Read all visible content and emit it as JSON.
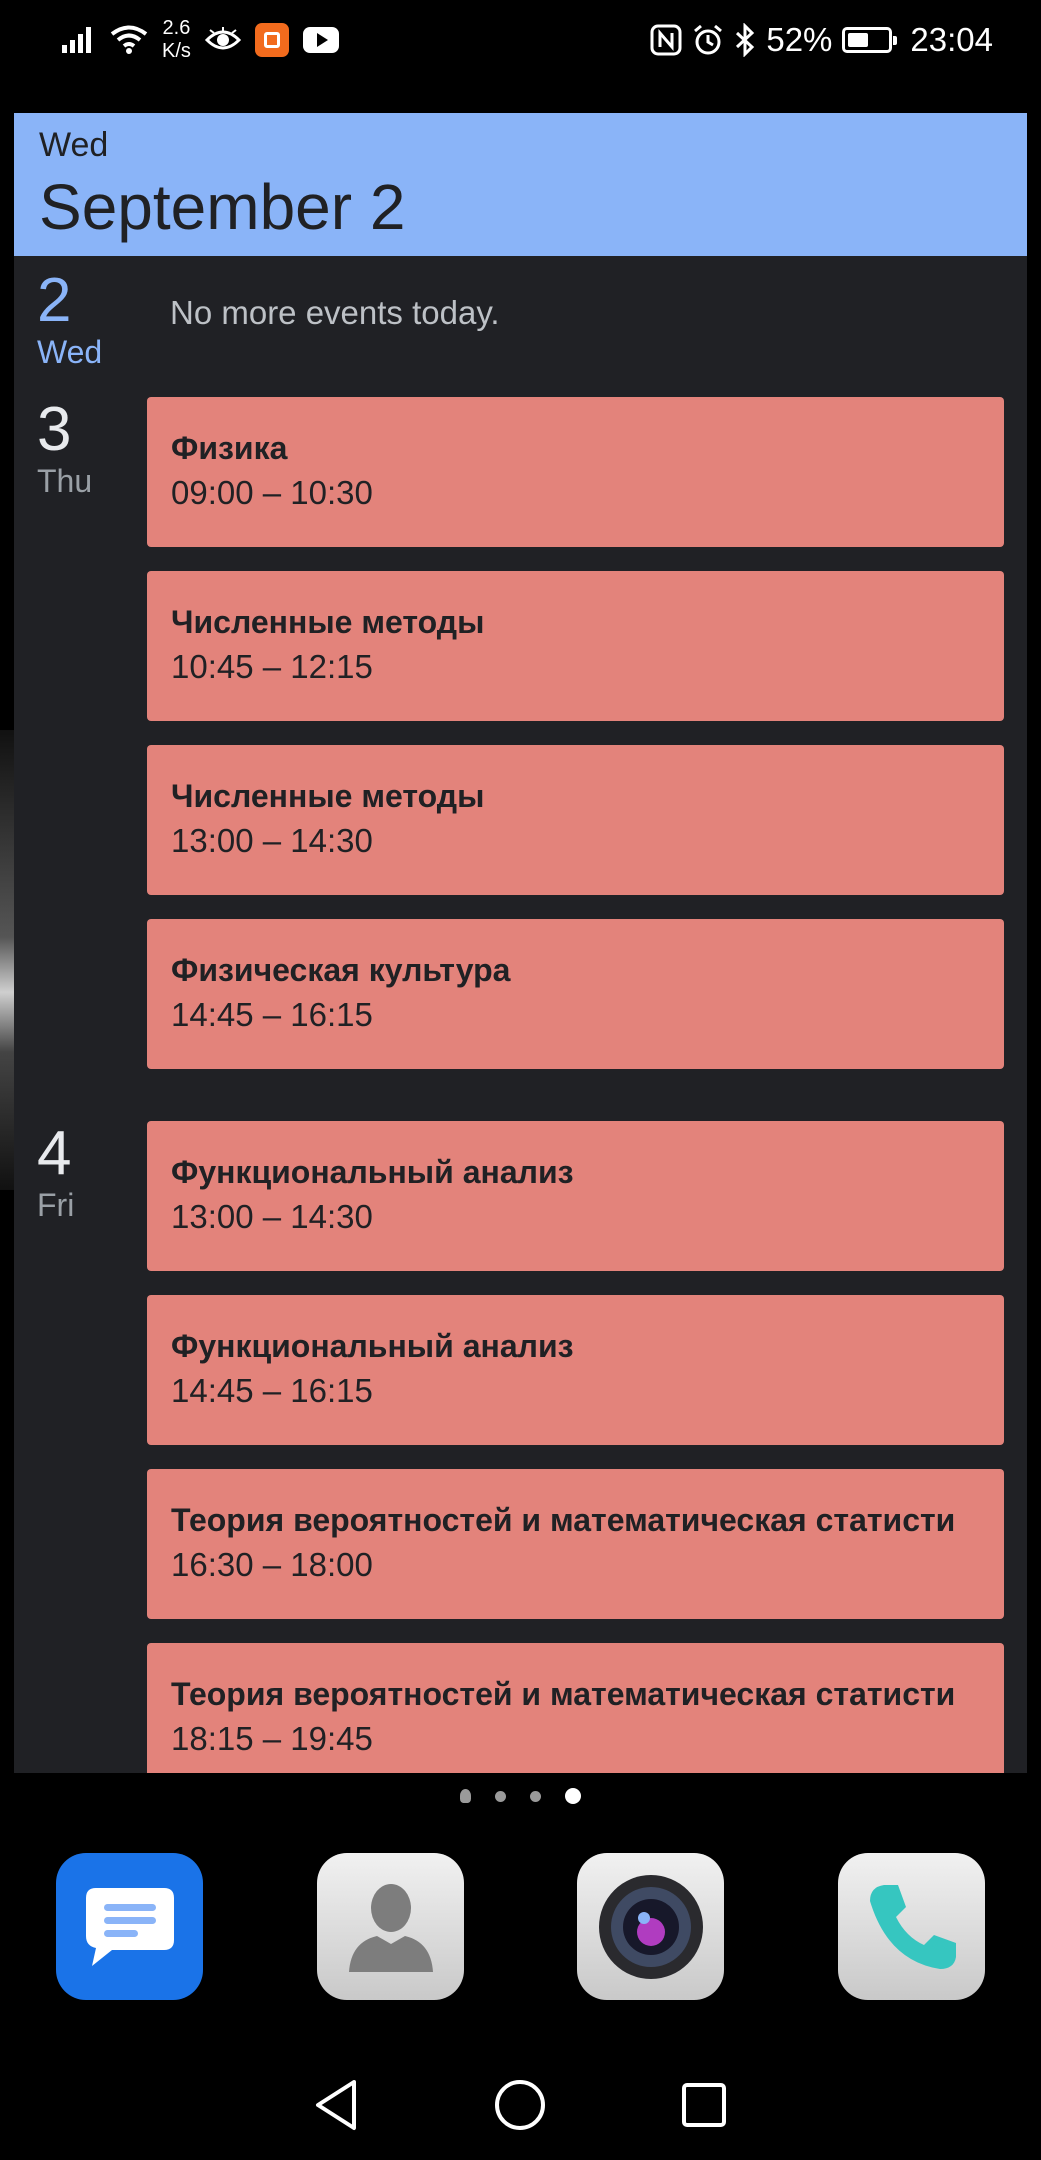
{
  "status_bar": {
    "network_speed": [
      "2.6",
      "K/s"
    ],
    "battery_percent": "52%",
    "battery_level": 0.52,
    "time": "23:04",
    "icons": [
      "signal-icon",
      "wifi-icon",
      "eye-icon",
      "mi-app-icon",
      "youtube-icon",
      "nfc-icon",
      "alarm-icon",
      "bluetooth-icon",
      "battery-icon"
    ]
  },
  "widget": {
    "header": {
      "weekday": "Wed",
      "date": "September 2"
    },
    "days": [
      {
        "num": "2",
        "name": "Wed",
        "today": true,
        "empty_text": "No more events today.",
        "events": []
      },
      {
        "num": "3",
        "name": "Thu",
        "events": [
          {
            "title": "Физика",
            "time": "09:00 – 10:30"
          },
          {
            "title": "Численные методы",
            "time": "10:45 – 12:15"
          },
          {
            "title": "Численные методы",
            "time": "13:00 – 14:30"
          },
          {
            "title": "Физическая культура",
            "time": "14:45 – 16:15"
          }
        ]
      },
      {
        "num": "4",
        "name": "Fri",
        "events": [
          {
            "title": "Функциональный анализ",
            "time": "13:00 – 14:30"
          },
          {
            "title": "Функциональный анализ",
            "time": "14:45 – 16:15"
          },
          {
            "title": "Теория вероятностей и математическая статисти",
            "time": "16:30 – 18:00"
          },
          {
            "title": "Теория вероятностей и математическая статисти",
            "time": "18:15 – 19:45"
          }
        ]
      }
    ],
    "event_color": "#e3837b",
    "accent_color": "#8ab4f8"
  },
  "home": {
    "page_count": 4,
    "active_page": 4,
    "dock": [
      {
        "name": "messages-app-icon"
      },
      {
        "name": "contacts-app-icon"
      },
      {
        "name": "camera-app-icon"
      },
      {
        "name": "phone-app-icon"
      }
    ]
  },
  "nav": {
    "buttons": [
      "back-icon",
      "home-icon",
      "recents-icon"
    ]
  }
}
